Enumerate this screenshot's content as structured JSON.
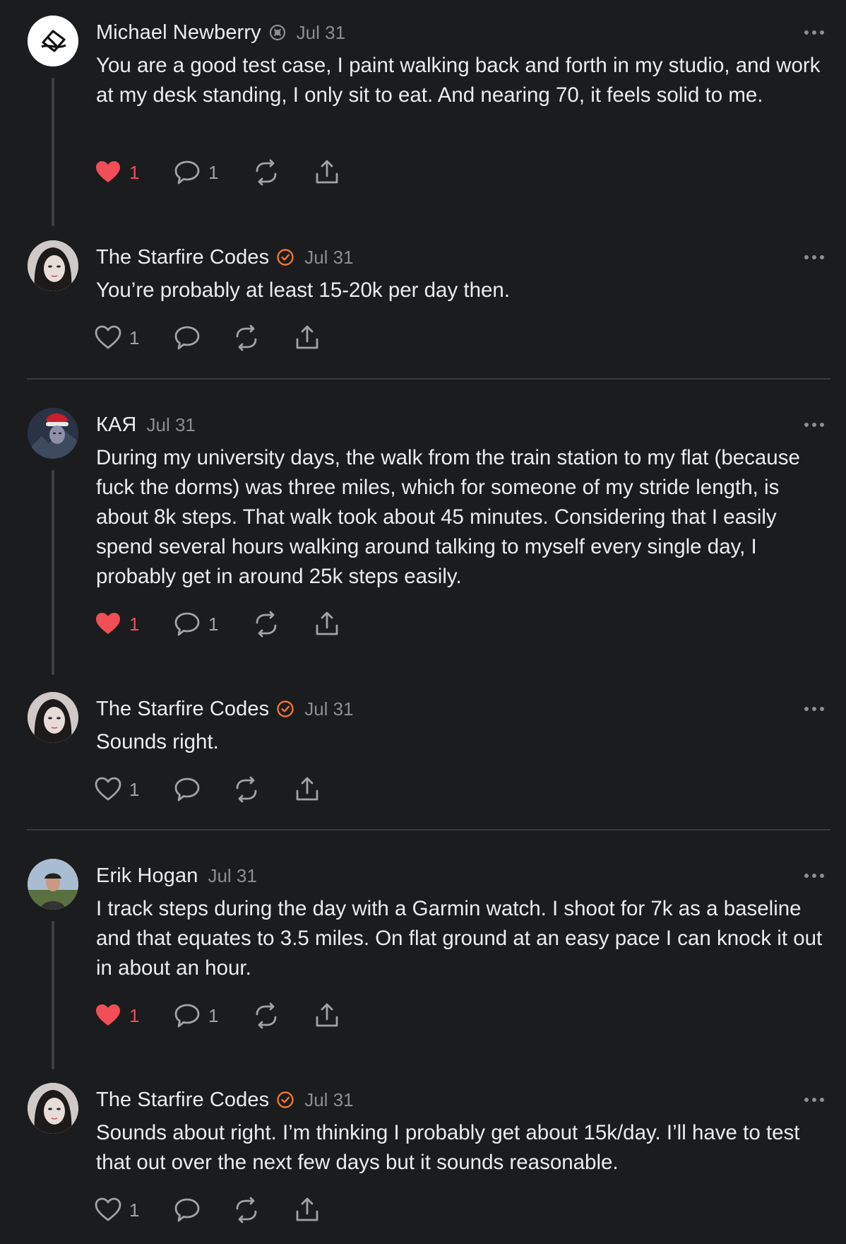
{
  "posts": [
    {
      "author": "Michael Newberry",
      "badge": "grey-badge-icon",
      "date": "Jul 31",
      "text": "You are a good test case, I paint walking back and forth in my studio, and work at my desk standing, I only sit to eat. And nearing 70, it feels solid to me.",
      "liked": true,
      "likes": "1",
      "comments": "1"
    },
    {
      "author": "The Starfire Codes",
      "badge": "verified-badge-icon",
      "date": "Jul 31",
      "text": "You’re probably at least 15-20k per day then.",
      "liked": false,
      "likes": "1",
      "comments": ""
    },
    {
      "author": "КАЯ",
      "badge": "",
      "date": "Jul 31",
      "text": "During my university days, the walk from the train station to my flat (because fuck the dorms) was three miles, which for someone of my stride length, is about 8k steps. That walk took about 45 minutes. Considering that I easily spend several hours walking around talking to myself every single day, I probably get in around 25k steps easily.",
      "liked": true,
      "likes": "1",
      "comments": "1"
    },
    {
      "author": "The Starfire Codes",
      "badge": "verified-badge-icon",
      "date": "Jul 31",
      "text": "Sounds right.",
      "liked": false,
      "likes": "1",
      "comments": ""
    },
    {
      "author": "Erik Hogan",
      "badge": "",
      "date": "Jul 31",
      "text": "I track steps during the day with a Garmin watch. I shoot for 7k as a baseline and that equates to 3.5 miles. On flat ground at an easy pace I can knock it out in about an hour.",
      "liked": true,
      "likes": "1",
      "comments": "1"
    },
    {
      "author": "The Starfire Codes",
      "badge": "verified-badge-icon",
      "date": "Jul 31",
      "text": "Sounds about right. I’m thinking I probably get about 15k/day. I’ll have to test that out over the next few days but it sounds reasonable.",
      "liked": false,
      "likes": "1",
      "comments": ""
    }
  ],
  "colors": {
    "background": "#1b1c1e",
    "like_active": "#f24e55",
    "verified": "#f0772f",
    "muted": "#8d8d92"
  }
}
